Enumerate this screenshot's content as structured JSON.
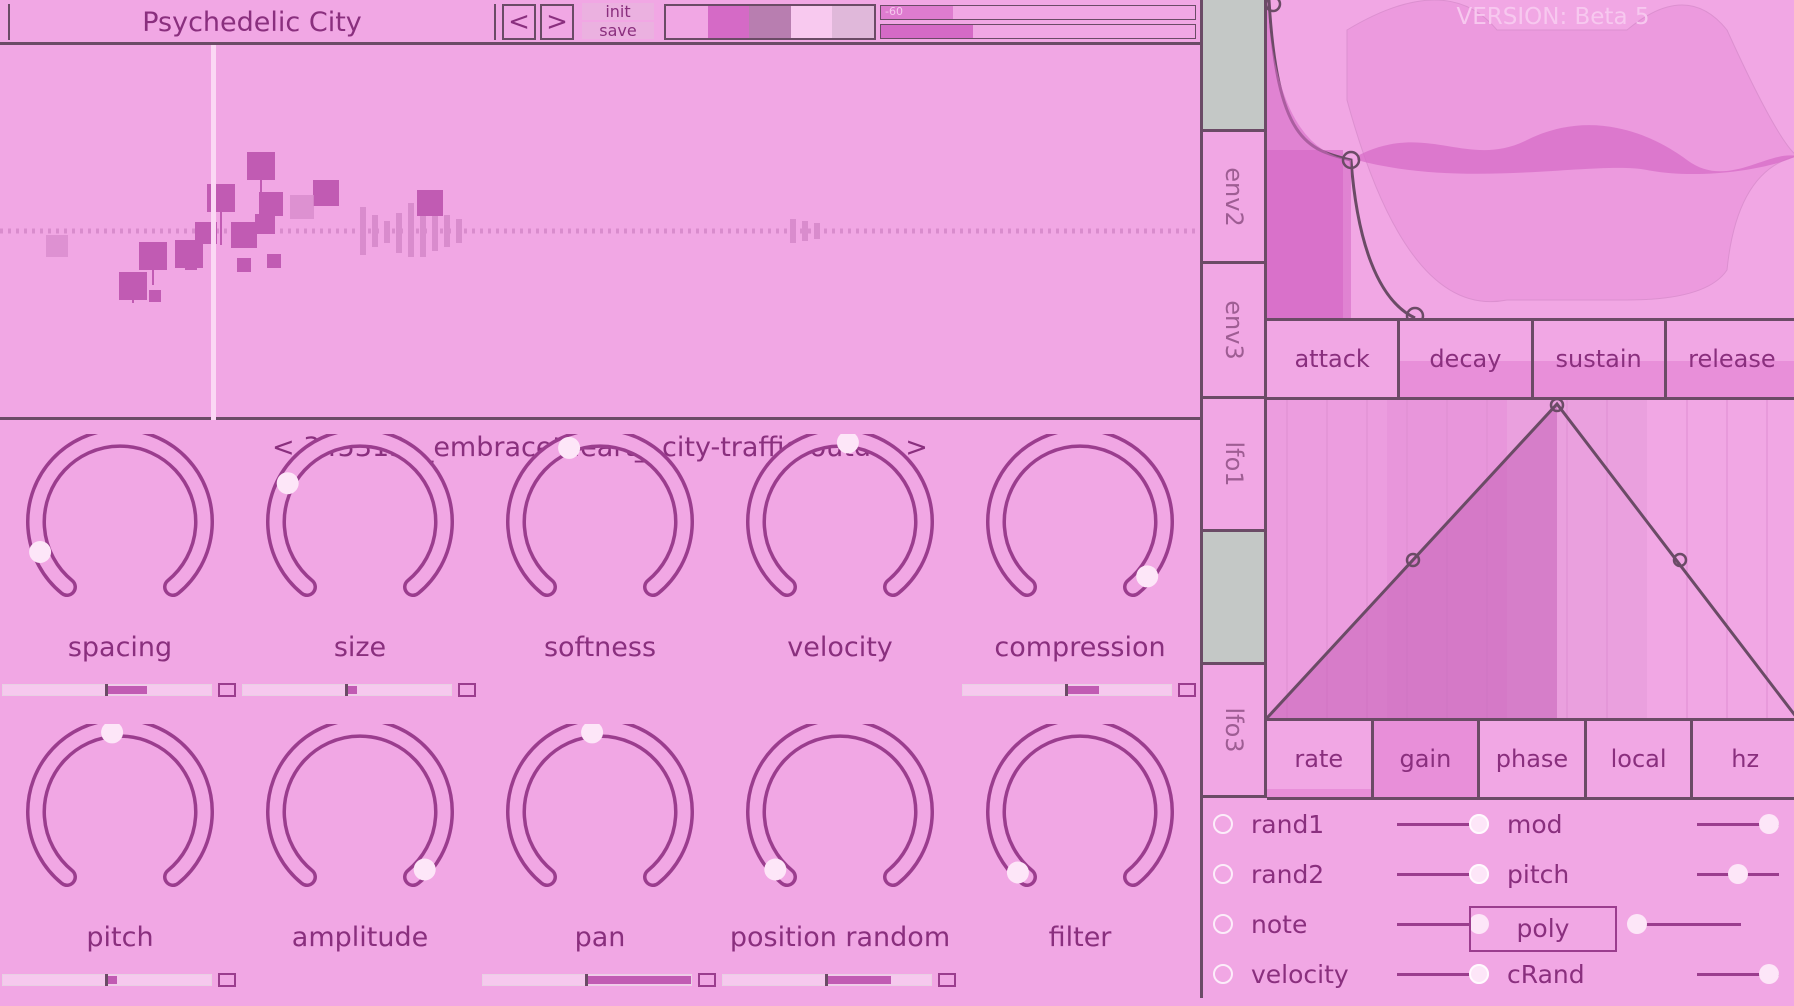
{
  "header": {
    "preset_name": "Psychedelic City",
    "prev_label": "<",
    "next_label": ">",
    "init_label": "init",
    "save_label": "save",
    "meter_label": "-60",
    "swatch_colors": [
      "#f1a7e4",
      "#d56ac6",
      "#b87eb0",
      "#f8c9ef",
      "#e0b8da"
    ]
  },
  "waveform": {
    "file_name": "< 345313__embracetheart__city-traffic-outd... >"
  },
  "knobs_row1": [
    {
      "label": "spacing",
      "value": 0.1
    },
    {
      "label": "size",
      "value": 0.28
    },
    {
      "label": "softness",
      "value": 0.42
    },
    {
      "label": "velocity",
      "value": 0.52
    },
    {
      "label": "compression",
      "value": 0.97
    }
  ],
  "knobs_row2": [
    {
      "label": "pitch",
      "value": 0.48
    },
    {
      "label": "amplitude",
      "value": 0.98
    },
    {
      "label": "pan",
      "value": 0.48
    },
    {
      "label": "position random",
      "value": 0.02
    },
    {
      "label": "filter",
      "value": 0.01
    }
  ],
  "envelope": {
    "version_label": "VERSION: Beta 5",
    "tabs": [
      "env2",
      "env3",
      "lfo1",
      "lfo3"
    ],
    "buttons": [
      "attack",
      "decay",
      "sustain",
      "release"
    ]
  },
  "lfo": {
    "buttons": [
      "rate",
      "gain",
      "phase",
      "local",
      "hz"
    ]
  },
  "modulation": {
    "left": [
      {
        "label": "rand1",
        "value": 1.0
      },
      {
        "label": "rand2",
        "value": 1.0
      },
      {
        "label": "note",
        "value": 1.0
      },
      {
        "label": "velocity",
        "value": 1.0
      }
    ],
    "right": [
      {
        "label": "mod",
        "value": 1.0
      },
      {
        "label": "pitch",
        "value": 0.5
      },
      {
        "label": "poly",
        "value": 0.0
      },
      {
        "label": "cRand",
        "value": 1.0
      }
    ]
  }
}
